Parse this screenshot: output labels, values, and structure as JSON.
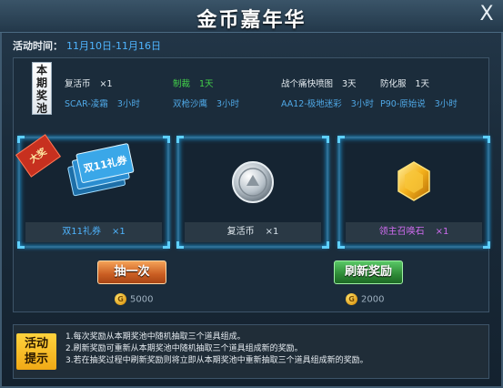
{
  "window": {
    "title": "金币嘉年华",
    "close_label": "X"
  },
  "event_time": {
    "label": "活动时间：",
    "value": "11月10日-11月16日"
  },
  "pool": {
    "tag": "本期奖池",
    "items": [
      {
        "name": "复活币",
        "duration": "×1",
        "style": "white"
      },
      {
        "name": "制裁",
        "duration": "1天",
        "style": "green"
      },
      {
        "name": "战个痛快喷图",
        "duration": "3天",
        "style": "white"
      },
      {
        "name": "防化服",
        "duration": "1天",
        "style": "white"
      },
      {
        "name": "SCAR-凌霜",
        "duration": "3小时",
        "style": "blue"
      },
      {
        "name": "双枪沙鹰",
        "duration": "3小时",
        "style": "blue"
      },
      {
        "name": "AA12-极地迷彩",
        "duration": "3小时",
        "style": "blue"
      },
      {
        "name": "P90-原始说",
        "duration": "3小时",
        "style": "blue"
      }
    ]
  },
  "rewards": [
    {
      "name": "双11礼券",
      "qty": "×1",
      "color": "blue",
      "badge": "大奖",
      "art_label": "双11礼券",
      "icon": "coupon-tickets-icon"
    },
    {
      "name": "复活币",
      "qty": "×1",
      "color": "white",
      "icon": "silver-coin-icon"
    },
    {
      "name": "领主召唤石",
      "qty": "×1",
      "color": "purple",
      "icon": "gold-gem-icon"
    }
  ],
  "actions": {
    "draw": {
      "label": "抽一次",
      "cost": "5000",
      "coin_glyph": "G"
    },
    "refresh": {
      "label": "刷新奖励",
      "cost": "2000",
      "coin_glyph": "G"
    }
  },
  "tips": {
    "tag": "活动提示",
    "lines": [
      "1.每次奖励从本期奖池中随机抽取三个道具组成。",
      "2.刷新奖励可重新从本期奖池中随机抽取三个道具组成新的奖励。",
      "3.若在抽奖过程中刷新奖励则将立即从本期奖池中重新抽取三个道具组成新的奖励。"
    ]
  },
  "colors": {
    "accent_blue": "#4fb5ff",
    "green": "#43d04a",
    "purple": "#d06cf0",
    "orange_button": "#c95d22",
    "green_button": "#2d8a36"
  }
}
